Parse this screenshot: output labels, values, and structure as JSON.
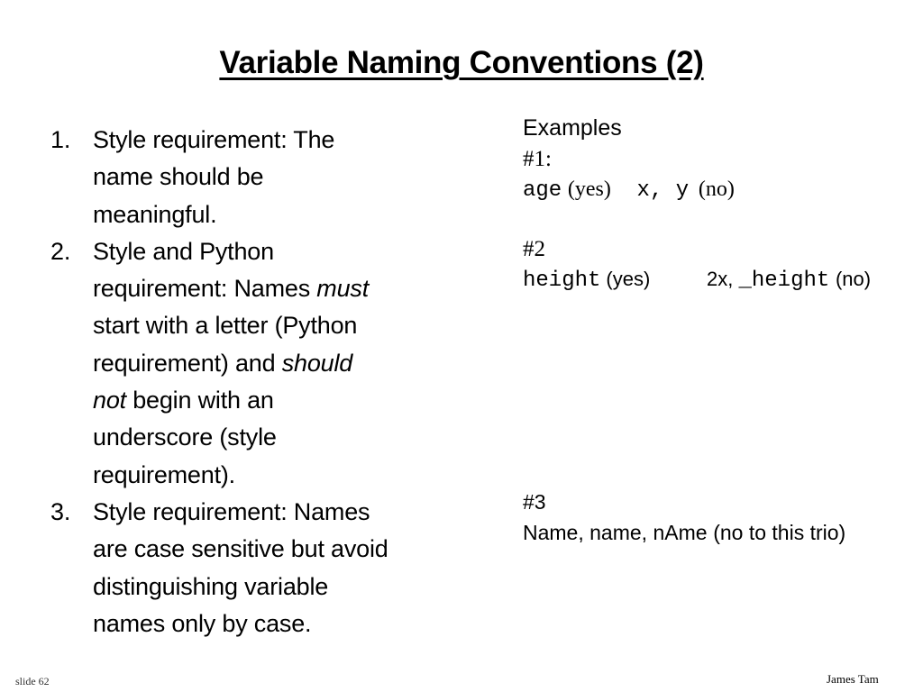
{
  "slide": {
    "title": "Variable Naming Conventions (2)",
    "list": [
      {
        "number": "1.",
        "lines": [
          "Style requirement: The",
          "name should be",
          "meaningful."
        ]
      },
      {
        "number": "2.",
        "line1": "Style and Python",
        "line2_prefix": "requirement: Names ",
        "line2_em": "must",
        "line3": "start with a letter (Python",
        "line4_prefix": "requirement) and ",
        "line4_em": "should",
        "line5_em": "not",
        "line5_suffix": " begin with an",
        "line6": "underscore (style",
        "line7": "requirement)."
      },
      {
        "number": "3.",
        "lines": [
          "Style requirement: Names",
          "are case sensitive but avoid",
          "distinguishing variable",
          "names only by case."
        ]
      }
    ],
    "examples": {
      "heading": "Examples",
      "ex1": {
        "label": "#1:",
        "good_name": "age",
        "good_verdict": "(yes)",
        "bad_names": "x, y",
        "bad_verdict": "(no)"
      },
      "ex2": {
        "label": "#2",
        "good_name": "height",
        "good_verdict": "(yes)",
        "bad_prefix": "2x, ",
        "bad_name": "_height",
        "bad_verdict": "(no)"
      },
      "ex3": {
        "label": "#3",
        "names": "Name, name, nAme",
        "verdict": "(no to this trio)"
      }
    },
    "footer": {
      "slide_number": "slide 62",
      "author": "James Tam"
    }
  }
}
